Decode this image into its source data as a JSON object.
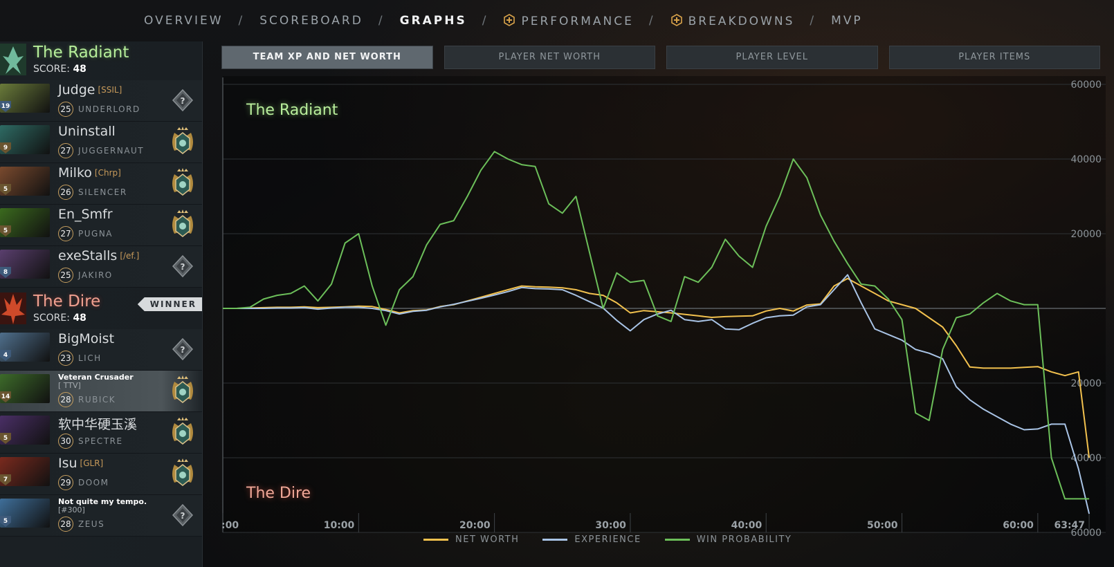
{
  "nav": [
    {
      "label": "OVERVIEW",
      "active": false,
      "plus": false
    },
    {
      "label": "SCOREBOARD",
      "active": false,
      "plus": false
    },
    {
      "label": "GRAPHS",
      "active": true,
      "plus": false
    },
    {
      "label": "PERFORMANCE",
      "active": false,
      "plus": true
    },
    {
      "label": "BREAKDOWNS",
      "active": false,
      "plus": true
    },
    {
      "label": "MVP",
      "active": false,
      "plus": false
    }
  ],
  "radiant": {
    "name": "The Radiant",
    "score_label": "SCORE:",
    "score": "48",
    "players": [
      {
        "name": "Judge",
        "tag": "[SSIL]",
        "level": "25",
        "hero": "UNDERLORD",
        "badge": "19",
        "rank": "unknown",
        "color": "#6a7b3a"
      },
      {
        "name": "Uninstall",
        "tag": "",
        "level": "27",
        "hero": "JUGGERNAUT",
        "badge": "9",
        "rank": "immortal",
        "color": "#2e6b64"
      },
      {
        "name": "Milko",
        "tag": "[Chrp]",
        "level": "26",
        "hero": "SILENCER",
        "badge": "5",
        "rank": "immortal",
        "color": "#7a4a2e"
      },
      {
        "name": "En_Smfr",
        "tag": "",
        "level": "27",
        "hero": "PUGNA",
        "badge": "5",
        "rank": "immortal",
        "color": "#3b6a1e"
      },
      {
        "name": "exeStalls",
        "tag": "[/ef.]",
        "level": "25",
        "hero": "JAKIRO",
        "badge": "8",
        "rank": "unknown",
        "color": "#5a3f6e"
      }
    ]
  },
  "dire": {
    "name": "The Dire",
    "score_label": "SCORE:",
    "score": "48",
    "winner": "WINNER",
    "players": [
      {
        "name": "BigMoist",
        "tag": "",
        "level": "23",
        "hero": "LICH",
        "badge": "4",
        "rank": "unknown",
        "color": "#4f6f8c",
        "small": false
      },
      {
        "name": "Veteran Crusader",
        "tag": "[ TTV]",
        "level": "28",
        "hero": "RUBICK",
        "badge": "14",
        "rank": "immortal",
        "color": "#3d6b2a",
        "small": true,
        "highlight": true
      },
      {
        "name": "软中华硬玉溪",
        "tag": "",
        "level": "30",
        "hero": "SPECTRE",
        "badge": "5",
        "rank": "immortal",
        "color": "#4a2f66",
        "small": false
      },
      {
        "name": "Isu",
        "tag": "[GLR]",
        "level": "29",
        "hero": "DOOM",
        "badge": "7",
        "rank": "immortal",
        "color": "#7a2a1e",
        "small": false
      },
      {
        "name": "Not quite my tempo.",
        "tag": "[#300]",
        "level": "28",
        "hero": "ZEUS",
        "badge": "5",
        "rank": "unknown",
        "color": "#3f6f9a",
        "small": true
      }
    ]
  },
  "tabs": [
    {
      "label": "TEAM XP AND NET WORTH",
      "active": true
    },
    {
      "label": "PLAYER NET WORTH",
      "active": false
    },
    {
      "label": "PLAYER LEVEL",
      "active": false
    },
    {
      "label": "PLAYER ITEMS",
      "active": false
    }
  ],
  "legend": [
    {
      "label": "NET WORTH",
      "color": "#f2c14e"
    },
    {
      "label": "EXPERIENCE",
      "color": "#a9c4e6"
    },
    {
      "label": "WIN PROBABILITY",
      "color": "#6cbf5a"
    }
  ],
  "chart_data": {
    "type": "line",
    "top_label": "The Radiant",
    "bottom_label": "The Dire",
    "x_ticks": [
      ":00",
      "10:00",
      "20:00",
      "30:00",
      "40:00",
      "50:00",
      "60:00",
      "63:47"
    ],
    "x_tick_minutes": [
      0,
      10,
      20,
      30,
      40,
      50,
      60,
      63.78
    ],
    "xlim": [
      0,
      65
    ],
    "y_ticks": [
      "60000",
      "40000",
      "20000",
      "20000",
      "40000",
      "60000"
    ],
    "y_tick_values": [
      60000,
      40000,
      20000,
      -20000,
      -40000,
      -60000
    ],
    "ylim": [
      -60000,
      60000
    ],
    "series": [
      {
        "name": "NET WORTH",
        "color": "#f2c14e",
        "x": [
          0,
          1,
          2,
          3,
          4,
          5,
          6,
          7,
          8,
          9,
          10,
          11,
          12,
          13,
          14,
          15,
          16,
          17,
          18,
          19,
          20,
          21,
          22,
          23,
          24,
          25,
          26,
          27,
          28,
          29,
          30,
          31,
          32,
          33,
          34,
          35,
          36,
          37,
          38,
          39,
          40,
          41,
          42,
          43,
          44,
          45,
          46,
          47,
          48,
          49,
          50,
          51,
          52,
          53,
          54,
          55,
          56,
          57,
          58,
          59,
          60,
          61,
          62,
          63,
          63.78
        ],
        "y": [
          0,
          0,
          100,
          200,
          300,
          300,
          400,
          200,
          300,
          400,
          600,
          500,
          -300,
          -1200,
          -600,
          -400,
          500,
          1000,
          2000,
          3000,
          4000,
          5000,
          6000,
          5800,
          5700,
          5500,
          5000,
          4000,
          3500,
          1500,
          -1200,
          -600,
          -900,
          -1200,
          -1600,
          -2000,
          -2400,
          -2200,
          -2100,
          -2000,
          -700,
          0,
          -700,
          900,
          1200,
          6000,
          8000,
          6000,
          4000,
          2000,
          1000,
          0,
          -2500,
          -5000,
          -10000,
          -15700,
          -16000,
          -16000,
          -16000,
          -15800,
          -15600,
          -17000,
          -18000,
          -17000,
          -40000
        ]
      },
      {
        "name": "EXPERIENCE",
        "color": "#a9c4e6",
        "x": [
          0,
          1,
          2,
          3,
          4,
          5,
          6,
          7,
          8,
          9,
          10,
          11,
          12,
          13,
          14,
          15,
          16,
          17,
          18,
          19,
          20,
          21,
          22,
          23,
          24,
          25,
          26,
          27,
          28,
          29,
          30,
          31,
          32,
          33,
          34,
          35,
          36,
          37,
          38,
          39,
          40,
          41,
          42,
          43,
          44,
          45,
          46,
          47,
          48,
          49,
          50,
          51,
          52,
          53,
          54,
          55,
          56,
          57,
          58,
          59,
          60,
          61,
          62,
          63,
          63.78
        ],
        "y": [
          0,
          0,
          0,
          0,
          100,
          100,
          200,
          -200,
          100,
          300,
          300,
          0,
          -600,
          -1500,
          -800,
          -500,
          400,
          1100,
          1900,
          2700,
          3600,
          4500,
          5600,
          5300,
          5200,
          5000,
          3500,
          1800,
          100,
          -3200,
          -6000,
          -3000,
          -1500,
          -500,
          -3000,
          -3500,
          -3000,
          -5500,
          -5700,
          -4000,
          -2500,
          -2000,
          -1800,
          400,
          1000,
          5000,
          9000,
          1500,
          -5500,
          -7000,
          -8500,
          -11000,
          -12000,
          -13500,
          -21000,
          -24500,
          -27000,
          -29000,
          -31000,
          -32500,
          -32300,
          -31000,
          -31000,
          -43000,
          -55000
        ]
      },
      {
        "name": "WIN PROBABILITY",
        "color": "#6cbf5a",
        "x": [
          0,
          1,
          2,
          3,
          4,
          5,
          6,
          7,
          8,
          9,
          10,
          11,
          12,
          13,
          14,
          15,
          16,
          17,
          18,
          19,
          20,
          21,
          22,
          23,
          24,
          25,
          26,
          27,
          28,
          29,
          30,
          31,
          32,
          33,
          34,
          35,
          36,
          37,
          38,
          39,
          40,
          41,
          42,
          43,
          44,
          45,
          46,
          47,
          48,
          49,
          50,
          51,
          52,
          53,
          54,
          55,
          56,
          57,
          58,
          59,
          60,
          61,
          62,
          63,
          63.78
        ],
        "y": [
          0,
          0,
          300,
          2500,
          3500,
          4000,
          6000,
          2000,
          6500,
          17500,
          20000,
          6000,
          -4500,
          5000,
          8500,
          17000,
          22500,
          23500,
          30000,
          37000,
          42000,
          40000,
          38500,
          38000,
          28000,
          25500,
          30000,
          15000,
          0,
          9500,
          7000,
          7500,
          -2000,
          -3500,
          8500,
          7000,
          11000,
          18500,
          14000,
          11000,
          22000,
          30000,
          40000,
          35000,
          25000,
          18000,
          12000,
          6500,
          6000,
          2500,
          -3000,
          -28000,
          -30000,
          -11000,
          -2500,
          -1500,
          1500,
          4000,
          2000,
          1000,
          1000,
          -40000,
          -51000,
          -51000,
          -51000
        ]
      }
    ]
  }
}
